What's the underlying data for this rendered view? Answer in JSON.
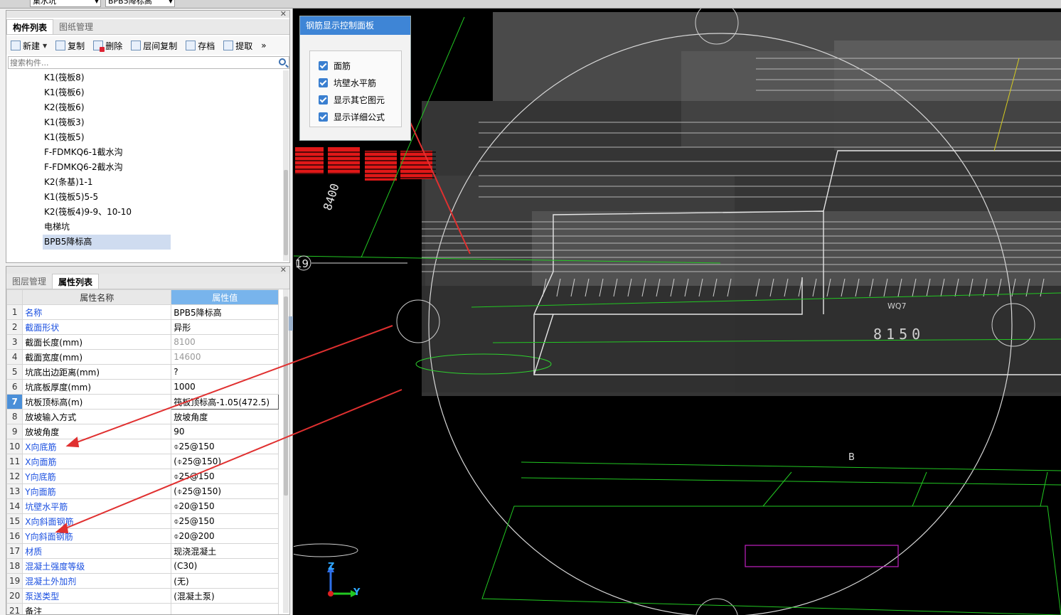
{
  "top_combos": [
    {
      "label": "集水坑"
    },
    {
      "label": "BPB5降标高"
    }
  ],
  "component_panel": {
    "tabs": [
      {
        "label": "构件列表"
      },
      {
        "label": "图纸管理"
      }
    ],
    "toolbar": {
      "new": "新建",
      "copy": "复制",
      "delete": "删除",
      "floor_copy": "层间复制",
      "save": "存档",
      "extract": "提取",
      "more": "»"
    },
    "search_placeholder": "搜索构件...",
    "items": [
      "K1(筏板8)",
      "K1(筏板6)",
      "K2(筏板6)",
      "K1(筏板3)",
      "K1(筏板5)",
      "F-FDMKQ6-1截水沟",
      "F-FDMKQ6-2截水沟",
      "K2(条基)1-1",
      "K1(筏板5)5-5",
      "K2(筏板4)9-9、10-10",
      "电梯坑",
      "BPB5降标高"
    ],
    "selected": "BPB5降标高"
  },
  "property_panel": {
    "tabs": [
      {
        "label": "图层管理"
      },
      {
        "label": "属性列表"
      }
    ],
    "headers": {
      "name": "属性名称",
      "value": "属性值"
    },
    "rows": [
      {
        "n": "1",
        "name": "名称",
        "value": "BPB5降标高",
        "blue": true
      },
      {
        "n": "2",
        "name": "截面形状",
        "value": "异形",
        "blue": true
      },
      {
        "n": "3",
        "name": "截面长度(mm)",
        "value": "8100",
        "blue": false,
        "grey": true
      },
      {
        "n": "4",
        "name": "截面宽度(mm)",
        "value": "14600",
        "blue": false,
        "grey": true
      },
      {
        "n": "5",
        "name": "坑底出边距离(mm)",
        "value": "?",
        "blue": false
      },
      {
        "n": "6",
        "name": "坑底板厚度(mm)",
        "value": "1000",
        "blue": false
      },
      {
        "n": "7",
        "name": "坑板顶标高(m)",
        "value": "筏板顶标高-1.05(472.5)",
        "blue": false,
        "current": true
      },
      {
        "n": "8",
        "name": "放坡输入方式",
        "value": "放坡角度",
        "blue": false
      },
      {
        "n": "9",
        "name": "放坡角度",
        "value": "90",
        "blue": false
      },
      {
        "n": "10",
        "name": "X向底筋",
        "value": "⌽25@150",
        "blue": true
      },
      {
        "n": "11",
        "name": "X向面筋",
        "value": "(⌽25@150)",
        "blue": true
      },
      {
        "n": "12",
        "name": "Y向底筋",
        "value": "⌽25@150",
        "blue": true
      },
      {
        "n": "13",
        "name": "Y向面筋",
        "value": "(⌽25@150)",
        "blue": true
      },
      {
        "n": "14",
        "name": "坑壁水平筋",
        "value": "⌽20@150",
        "blue": true
      },
      {
        "n": "15",
        "name": "X向斜面钢筋",
        "value": "⌽25@150",
        "blue": true
      },
      {
        "n": "16",
        "name": "Y向斜面钢筋",
        "value": "⌽20@200",
        "blue": true
      },
      {
        "n": "17",
        "name": "材质",
        "value": "现浇混凝土",
        "blue": true
      },
      {
        "n": "18",
        "name": "混凝土强度等级",
        "value": "(C30)",
        "blue": true
      },
      {
        "n": "19",
        "name": "混凝土外加剂",
        "value": "(无)",
        "blue": true
      },
      {
        "n": "20",
        "name": "泵送类型",
        "value": "(混凝土泵)",
        "blue": true
      },
      {
        "n": "21",
        "name": "备注",
        "value": "",
        "blue": false
      }
    ]
  },
  "control_panel": {
    "title": "钢筋显示控制面板",
    "options": [
      {
        "label": "面筋",
        "checked": true
      },
      {
        "label": "坑壁水平筋",
        "checked": true
      },
      {
        "label": "显示其它图元",
        "checked": true
      },
      {
        "label": "显示详细公式",
        "checked": true
      }
    ]
  },
  "viewport_labels": {
    "dim_8400": "8400",
    "dim_8150": "8150",
    "axis_19": "19",
    "wq7": "WQ7",
    "b": "B",
    "axis_z": "Z",
    "axis_y": "Y"
  },
  "colors": {
    "accent_blue": "#3e85d6",
    "prop_blue": "#1a4fe0",
    "annotation_red": "#e03030",
    "grid_green": "#1fd12f",
    "magenta": "#c020c0"
  }
}
